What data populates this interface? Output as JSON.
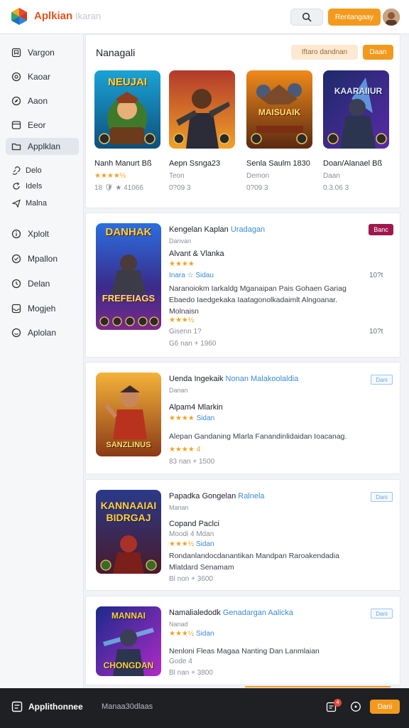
{
  "header": {
    "brand": "Aplkian",
    "brand_sub": "Ikaran",
    "search_icon": "search-icon",
    "cta_label": "Rentangaay",
    "colors": {
      "accent": "#f39a1e",
      "brand": "#e2531c"
    }
  },
  "sidebar": {
    "items": [
      {
        "label": "Vargon",
        "icon": "bookmark-icon"
      },
      {
        "label": "Kaoar",
        "icon": "target-icon"
      },
      {
        "label": "Aaon",
        "icon": "compass-icon"
      },
      {
        "label": "Eeor",
        "icon": "card-icon"
      },
      {
        "label": "Applklan",
        "icon": "folder-icon",
        "active": true
      },
      {
        "label": "Delo",
        "icon": "link-icon"
      },
      {
        "label": "Idels",
        "icon": "refresh-icon"
      },
      {
        "label": "Malna",
        "icon": "send-icon"
      },
      {
        "label": "Xplolt",
        "icon": "info-icon"
      },
      {
        "label": "Mpallon",
        "icon": "check-circle-icon"
      },
      {
        "label": "Delan",
        "icon": "clock-icon"
      },
      {
        "label": "Mogjeh",
        "icon": "inbox-icon"
      },
      {
        "label": "Aplolan",
        "icon": "smile-icon"
      }
    ]
  },
  "featured": {
    "title": "Nanagali",
    "filter_label": "Iftaro dandnan",
    "action_label": "Daan",
    "games": [
      {
        "name": "Nanh Manurt Bß",
        "sub": "★★★★½",
        "meta": "18 🛡 ★ 41066",
        "thumb_title": "NEUJAI"
      },
      {
        "name": "Aepn Ssnga23",
        "sub": "Teon",
        "meta": "0?09 3",
        "thumb_title": ""
      },
      {
        "name": "Senla Saulm 1830",
        "sub": "Demon",
        "meta": "0?09 3",
        "thumb_title": "MAISUAIK"
      },
      {
        "name": "Doan/Alanael Bß",
        "sub": "Daan",
        "meta": "0.3.06 3",
        "thumb_title": "KAARAIIUR"
      }
    ]
  },
  "list": [
    {
      "title": "Kengelan Kaplan",
      "title_link": "Uradagan",
      "sub": "Danvan",
      "badge": "Banc",
      "heading": "Alvant & Vlanka",
      "rating": "★★★★",
      "rating_text": "Inara ☆ Sidau",
      "rating_right": "10?t",
      "desc": "Naranoiokm Iarkaldg Mganaipan Pais Gohaen Gariag Ebaedo Iaedgekaka Iaatagonolkadaimlt Alngoanar. Molnaisn",
      "rating2": "★★★½",
      "note": "Gisenn 1?",
      "note_right": "10?t",
      "meta": "G6 nan + 1960",
      "thumb_title": "DANHAK",
      "thumb_bottom": "FREFEIAGS"
    },
    {
      "title": "Uenda Ingekaik",
      "title_link": "Nonan Malakoolaldia",
      "sub": "Danan",
      "badge": "Dani",
      "heading": "Alpam4 Mlarkin",
      "rating": "★★★★",
      "rating_text": "Sidan",
      "desc": "Alepan Gandaning Mlarla Fanandinlidaidan Ioacanag.",
      "rating2": "★★★★ 4",
      "meta": "83 nan + 1500",
      "thumb_title": "",
      "thumb_bottom": "SANZLINUS"
    },
    {
      "title": "Papadka Gongelan",
      "title_link": "Ralnela",
      "sub": "Manan",
      "badge": "Dani",
      "heading": "Copand Paclci",
      "rating_text": "Moodi 4 Mdan",
      "rating": "★★★½",
      "rating_text2": "Sidan",
      "desc": "Rondanlandocdanantikan Mandpan Raroakendadia Mlatdard Senamam",
      "meta": "Bl non + 3600",
      "thumb_title": "KANNAAIAI BIDRGAJ",
      "thumb_bottom": ""
    },
    {
      "title": "Namalialedodk",
      "title_link": "Genadargan Aalicka",
      "sub": "Nanad",
      "badge": "Dani",
      "rating": "★★★½",
      "rating_text": "Sidan",
      "desc": "Nenloni Fleas Magaa Nanting Dan Lanmlaian",
      "note": "Gode 4",
      "meta": "Bl nan + 3800",
      "thumb_title": "MANNAI",
      "thumb_bottom": "CHONGDAN"
    }
  ],
  "bottombar": {
    "title": "Applithonnee",
    "sub": "Manaa30dlaas",
    "notif_count": "4",
    "button": "Dani"
  }
}
